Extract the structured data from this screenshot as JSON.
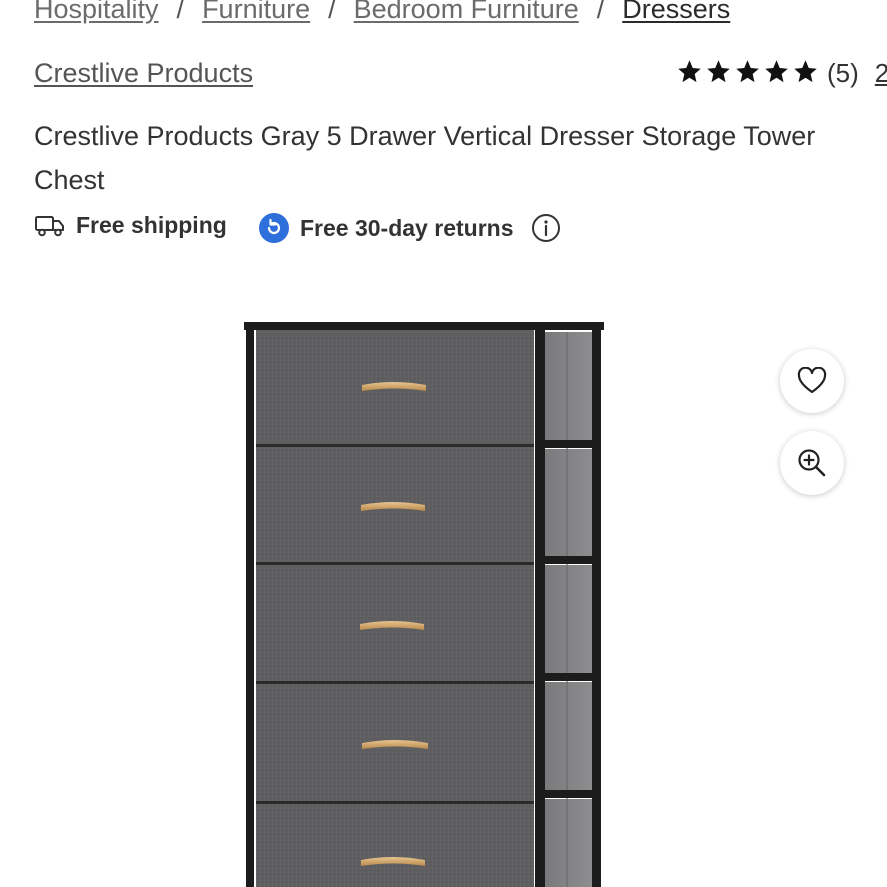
{
  "breadcrumbs": [
    "Hospitality",
    "Furniture",
    "Bedroom Furniture",
    "Dressers"
  ],
  "breadcrumb_separator": "/",
  "brand": "Crestlive Products",
  "rating": {
    "stars": 5,
    "count_label": "(5)",
    "extra_label": "2"
  },
  "product_title": "Crestlive Products Gray 5 Drawer Vertical Dresser Storage Tower Chest",
  "perks": {
    "shipping": "Free shipping",
    "returns": "Free 30-day returns"
  },
  "product_image": {
    "drawer_count": 5,
    "fabric_color": "#5f5f61",
    "frame_color": "#1c1c1c",
    "handle_color": "#d1a46a"
  },
  "actions": {
    "favorite_icon": "heart-icon",
    "zoom_icon": "zoom-in-icon"
  },
  "colors": {
    "returns_badge": "#2f6fdc",
    "text": "#333333",
    "link": "#6b6b6b"
  }
}
